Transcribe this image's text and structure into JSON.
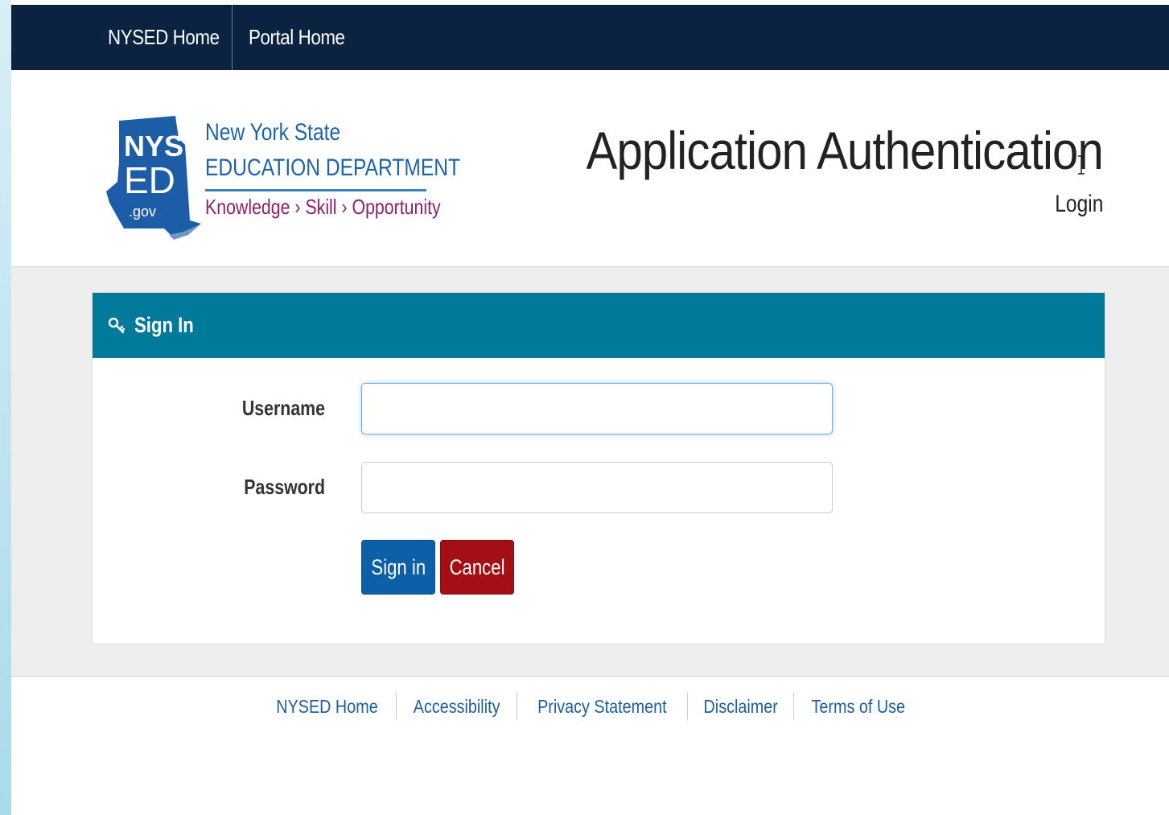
{
  "topnav": {
    "links": [
      {
        "label": "NYSED Home"
      },
      {
        "label": "Portal Home"
      }
    ]
  },
  "logo": {
    "emblem_top": "NYS",
    "emblem_mid": "ED",
    "emblem_bottom": ".gov",
    "line1": "New York State",
    "line2": "EDUCATION DEPARTMENT",
    "line3": "Knowledge › Skill › Opportunity"
  },
  "header": {
    "title": "Application Authentication",
    "subtitle": "Login"
  },
  "signin": {
    "title": "Sign In",
    "icon": "key-icon",
    "username_label": "Username",
    "username_value": "",
    "password_label": "Password",
    "password_value": "",
    "signin_button": "Sign in",
    "cancel_button": "Cancel"
  },
  "footer": {
    "links": [
      {
        "label": "NYSED Home"
      },
      {
        "label": "Accessibility"
      },
      {
        "label": "Privacy Statement"
      },
      {
        "label": "Disclaimer"
      },
      {
        "label": "Terms of Use"
      }
    ]
  },
  "colors": {
    "nav_bg": "#0b2340",
    "panel_heading": "#007a9a",
    "signin_button": "#0d5fa7",
    "cancel_button": "#a30f14",
    "link": "#1d5f9e"
  }
}
